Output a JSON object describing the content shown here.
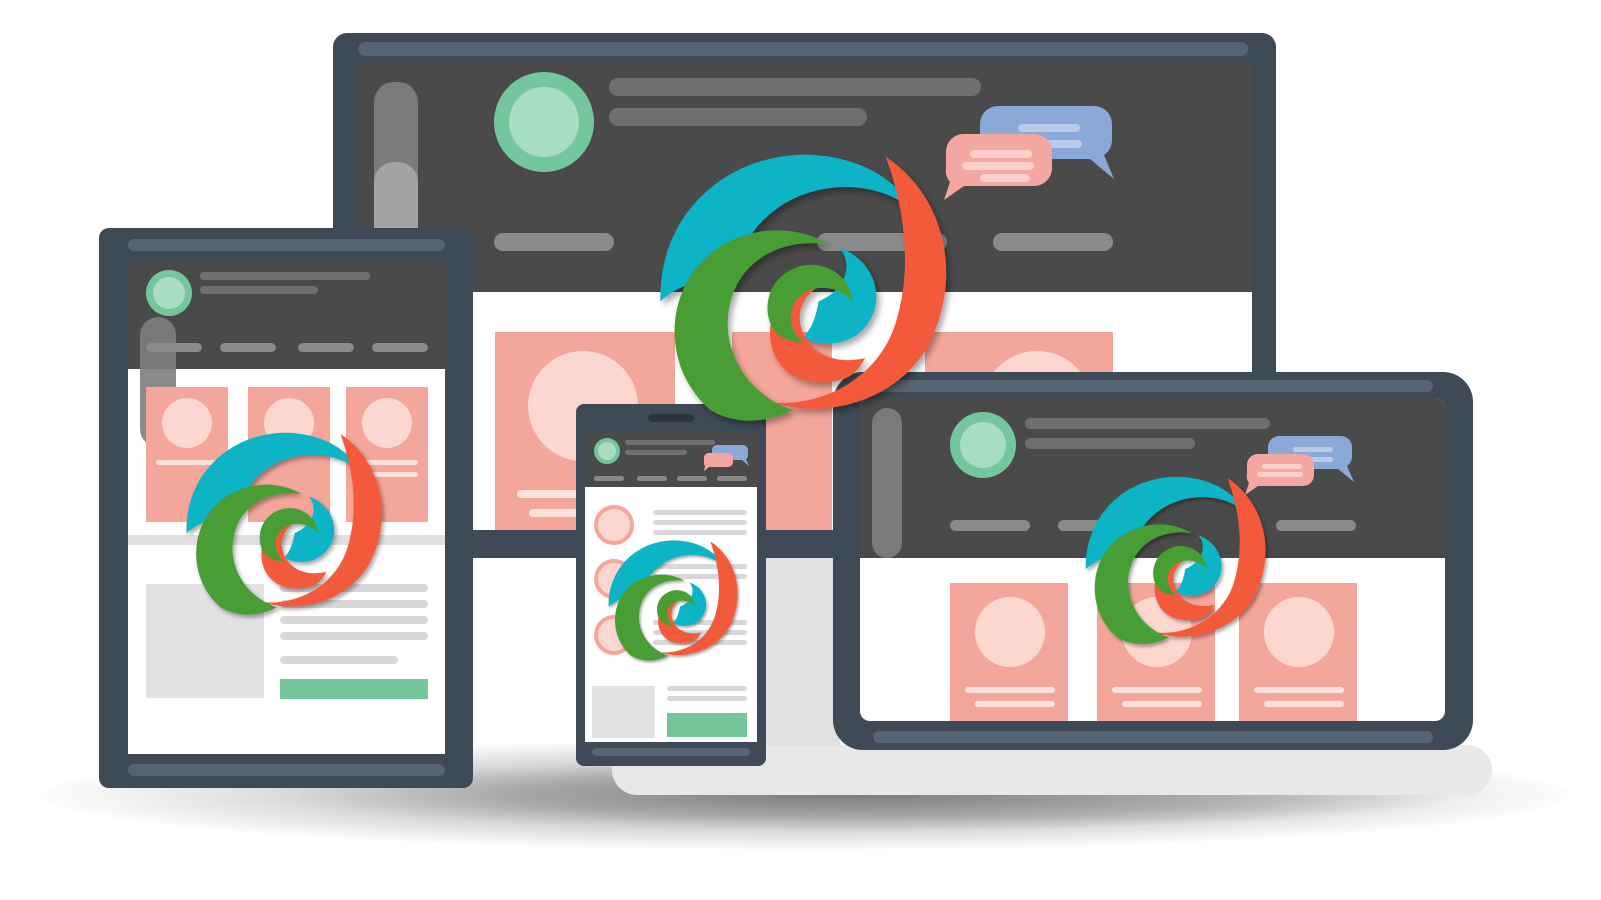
{
  "illustration": {
    "subject": "responsive-devices-mockup",
    "devices": [
      "desktop-monitor",
      "tablet-portrait",
      "smartphone",
      "tablet-landscape"
    ]
  },
  "colors": {
    "device_frame": "#3e4a55",
    "screen_header": "#4a4a4a",
    "card_salmon": "#f5a69a",
    "accent_green": "#74c69d",
    "bubble_pink": "#f4a7a0",
    "bubble_blue": "#8aa9d6",
    "logo_teal": "#0ab4c6",
    "logo_green": "#4a9d34",
    "logo_red": "#f25a3a"
  },
  "icons": {
    "brand_logo": "swirl-logo-icon",
    "chat": "chat-bubbles-icon",
    "avatar": "avatar-icon"
  }
}
